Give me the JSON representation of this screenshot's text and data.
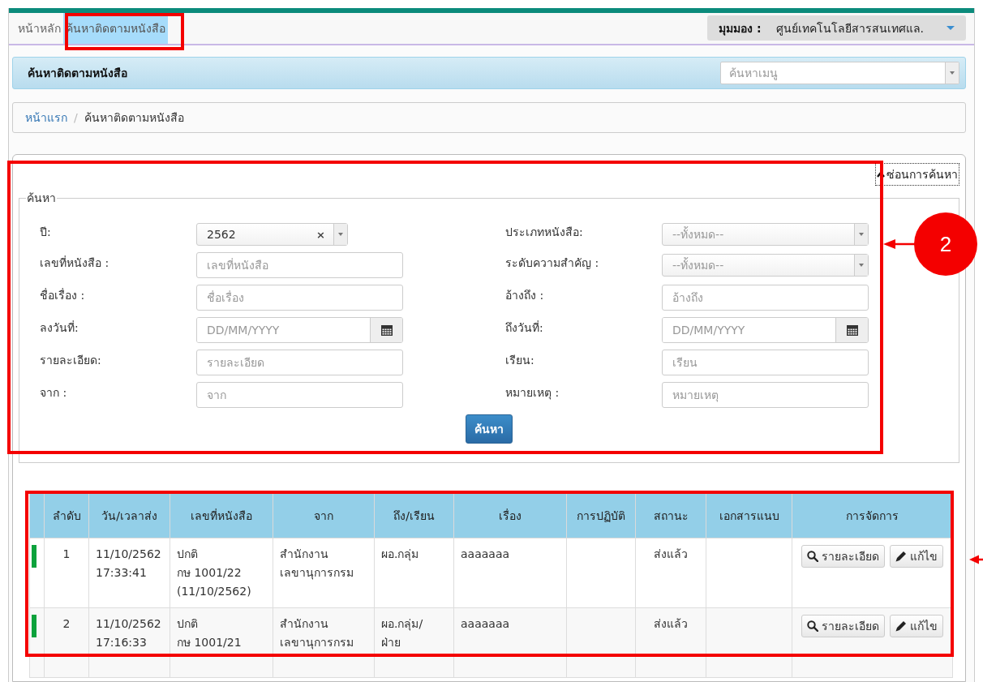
{
  "nav": {
    "items": [
      {
        "label": "หน้าหลัก",
        "selected": false
      },
      {
        "label": "ค้นหาติดตามหนังสือ",
        "selected": true
      }
    ],
    "view_label": "มุมมอง :",
    "view_value": "ศูนย์เทคโนโลยีสารสนเทศแล."
  },
  "page_header": {
    "title": "ค้นหาติดตามหนังสือ",
    "menu_search": {
      "placeholder": "ค้นหาเมนู"
    }
  },
  "breadcrumb": [
    {
      "label": "หน้าแรก",
      "kind": "link"
    },
    {
      "label": "/",
      "kind": "separator"
    },
    {
      "label": "ค้นหาติดตามหนังสือ",
      "kind": "current"
    }
  ],
  "search_panel": {
    "toggle": "ซ่อนการค้นหา",
    "legend": "ค้นหา",
    "left_fields": [
      {
        "label": "ปี:",
        "kind": "select",
        "value": "2562",
        "clearable": true,
        "clear_glyph": "×"
      },
      {
        "label": "เลขที่หนังสือ :",
        "kind": "text",
        "placeholder": "เลขที่หนังสือ"
      },
      {
        "label": "ชื่อเรื่อง :",
        "kind": "text",
        "placeholder": "ชื่อเรื่อง"
      },
      {
        "label": "ลงวันที่:",
        "kind": "date",
        "placeholder": "DD/MM/YYYY"
      },
      {
        "label": "รายละเอียด:",
        "kind": "text",
        "placeholder": "รายละเอียด"
      },
      {
        "label": "จาก :",
        "kind": "text",
        "placeholder": "จาก"
      }
    ],
    "right_fields": [
      {
        "label": "ประเภทหนังสือ:",
        "kind": "select",
        "placeholder": "--ทั้งหมด--",
        "clearable": false
      },
      {
        "label": "ระดับความสำคัญ :",
        "kind": "select",
        "placeholder": "--ทั้งหมด--",
        "clearable": false
      },
      {
        "label": "อ้างถึง :",
        "kind": "text",
        "placeholder": "อ้างถึง"
      },
      {
        "label": "ถึงวันที่:",
        "kind": "date",
        "placeholder": "DD/MM/YYYY"
      },
      {
        "label": "เรียน:",
        "kind": "text",
        "placeholder": "เรียน"
      },
      {
        "label": "หมายเหตุ :",
        "kind": "text",
        "placeholder": "หมายเหตุ"
      }
    ],
    "submit": "ค้นหา"
  },
  "table": {
    "columns": [
      "ลำดับ",
      "วัน/เวลาส่ง",
      "เลขที่หนังสือ",
      "จาก",
      "ถึง/เรียน",
      "เรื่อง",
      "การปฏิบัติ",
      "สถานะ",
      "เอกสารแนบ",
      "การจัดการ"
    ],
    "rows": [
      {
        "color": "#0ca23c",
        "cells": [
          "1",
          "11/10/2562\n17:33:41",
          "ปกติ\nกษ 1001/22\n(11/10/2562)",
          "สำนักงาน\nเลขานุการกรม",
          "ผอ.กลุ่ม",
          "aaaaaaa",
          "",
          "ส่งแล้ว",
          ""
        ],
        "actions": [
          {
            "kind": "view",
            "label": "รายละเอียด"
          },
          {
            "kind": "edit",
            "label": "แก้ไข"
          }
        ]
      },
      {
        "color": "#0ca23c",
        "cells": [
          "2",
          "11/10/2562\n17:16:33",
          "ปกติ\nกษ 1001/21",
          "สำนักงาน\nเลขานุการกรม",
          "ผอ.กลุ่ม/\nฝ่าย",
          "aaaaaaa",
          "",
          "ส่งแล้ว",
          ""
        ],
        "actions": [
          {
            "kind": "view",
            "label": "รายละเอียด"
          },
          {
            "kind": "edit",
            "label": "แก้ไข"
          }
        ]
      }
    ]
  },
  "annotations": {
    "callout": "2"
  }
}
